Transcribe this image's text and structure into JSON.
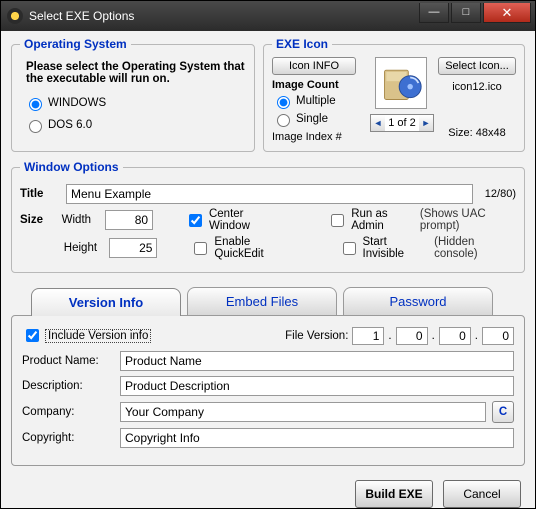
{
  "window": {
    "title": "Select EXE Options"
  },
  "os": {
    "legend": "Operating System",
    "prompt": "Please select the Operating System that the executable will run on.",
    "options": [
      "WINDOWS",
      "DOS 6.0"
    ],
    "selected": "WINDOWS"
  },
  "exe": {
    "legend": "EXE Icon",
    "info_btn": "Icon INFO",
    "select_btn": "Select Icon...",
    "image_count_label": "Image Count",
    "multiple": "Multiple",
    "single": "Single",
    "count_selected": "Multiple",
    "index_label": "Image Index #",
    "index_value": "1 of 2",
    "filename": "icon12.ico",
    "size": "Size: 48x48"
  },
  "wopts": {
    "legend": "Window Options",
    "title_label": "Title",
    "title_value": "Menu Example",
    "title_counter": "12/80)",
    "size_label": "Size",
    "width_label": "Width",
    "width_value": "80",
    "height_label": "Height",
    "height_value": "25",
    "center": "Center Window",
    "quickedit": "Enable QuickEdit",
    "runadmin": "Run as Admin",
    "runadmin_hint": "(Shows UAC prompt)",
    "invisible": "Start Invisible",
    "invisible_hint": "(Hidden console)"
  },
  "tabs": {
    "version": "Version Info",
    "embed": "Embed Files",
    "password": "Password"
  },
  "version": {
    "include": "Include Version info",
    "fv_label": "File Version:",
    "fv": [
      "1",
      "0",
      "0",
      "0"
    ],
    "product_label": "Product Name:",
    "product": "Product Name",
    "desc_label": "Description:",
    "desc": "Product Description",
    "company_label": "Company:",
    "company": "Your Company",
    "copyright_label": "Copyright:",
    "copyright": "Copyright Info",
    "cbtn": "C"
  },
  "footer": {
    "build": "Build EXE",
    "cancel": "Cancel"
  }
}
